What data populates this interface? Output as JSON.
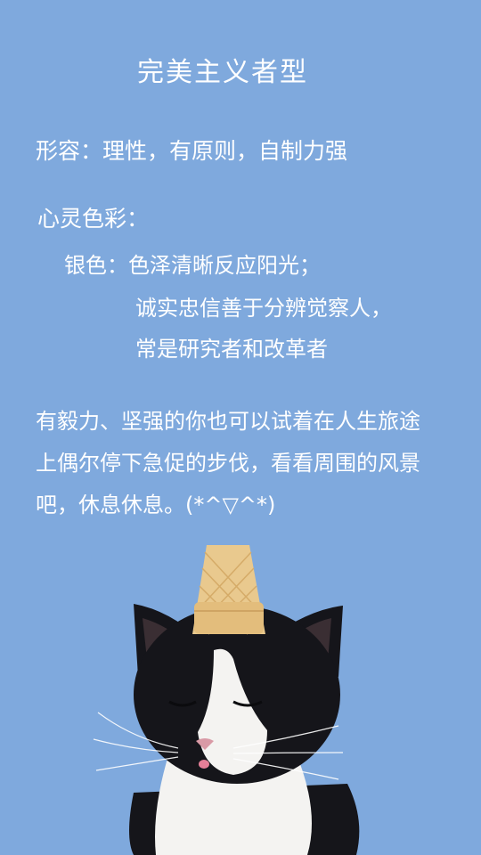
{
  "title": "完美主义者型",
  "description": "形容：理性，有原则，自制力强",
  "colors_section": {
    "label": "心灵色彩：",
    "color_name": "银色：色泽清晰反应阳光；",
    "lines": [
      "诚实忠信善于分辨觉察人，",
      "常是研究者和改革者"
    ]
  },
  "advice": {
    "lines": [
      "有毅力、坚强的你也可以试着在人生旅途",
      "上偶尔停下急促的步伐，看看周围的风景",
      "吧，休息休息。(*^▽^*)"
    ]
  },
  "colors": {
    "background": "#7fa9dd",
    "text": "#ffffff",
    "cone": "#e9c98e",
    "cat_black": "#15151a",
    "cat_white": "#f4f3f1"
  }
}
